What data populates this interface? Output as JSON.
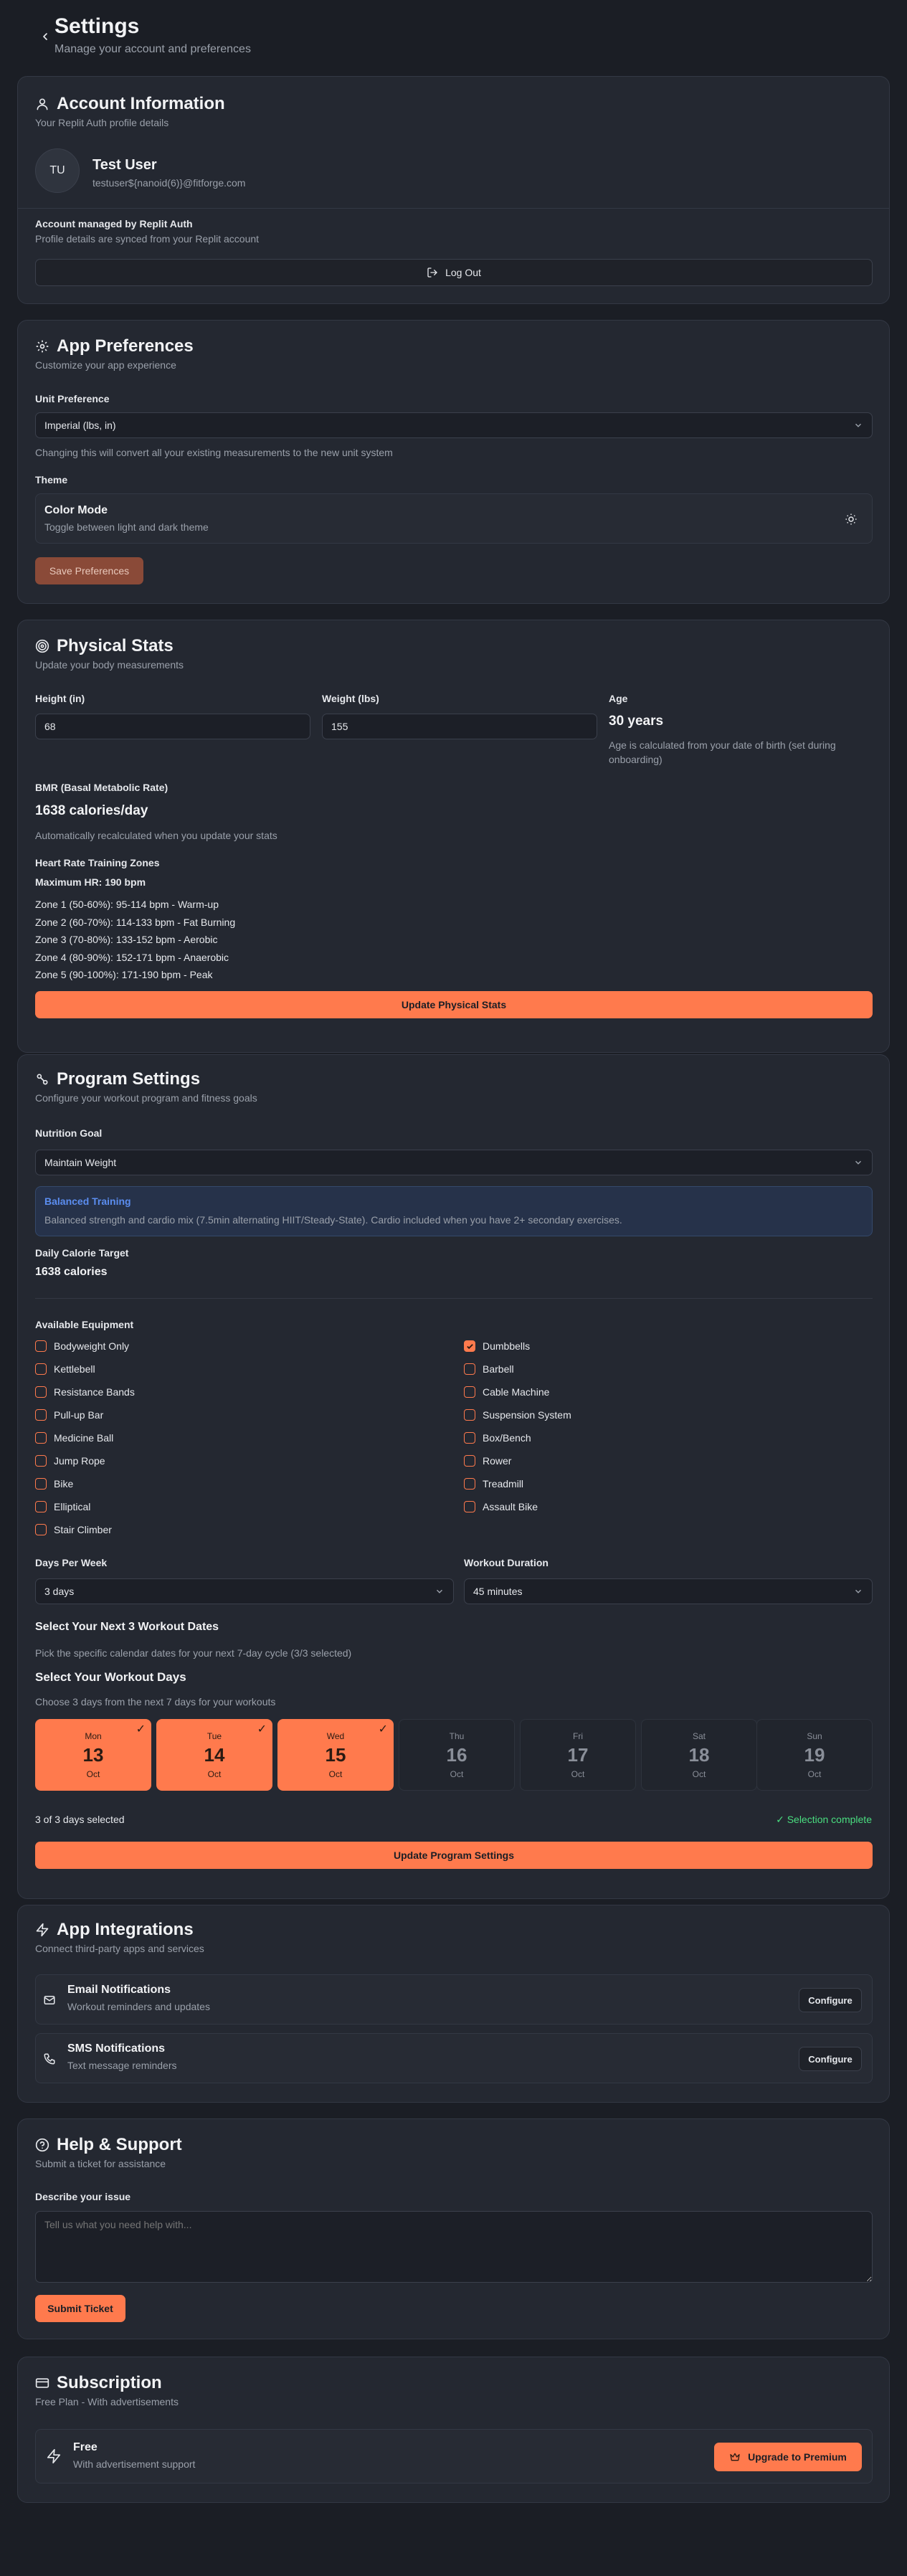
{
  "header": {
    "title": "Settings",
    "subtitle": "Manage your account and preferences"
  },
  "account": {
    "title": "Account Information",
    "subtitle": "Your Replit Auth profile details",
    "avatar_initials": "TU",
    "name": "Test User",
    "email": "testuser${nanoid(6)}@fitforge.com",
    "managed_label": "Account managed by Replit Auth",
    "managed_note": "Profile details are synced from your Replit account",
    "logout_label": "Log Out"
  },
  "preferences": {
    "title": "App Preferences",
    "subtitle": "Customize your app experience",
    "unit_label": "Unit Preference",
    "unit_value": "Imperial (lbs, in)",
    "unit_note": "Changing this will convert all your existing measurements to the new unit system",
    "theme_label": "Theme",
    "color_mode_title": "Color Mode",
    "color_mode_sub": "Toggle between light and dark theme",
    "save_label": "Save Preferences"
  },
  "physical": {
    "title": "Physical Stats",
    "subtitle": "Update your body measurements",
    "height_label": "Height (in)",
    "height_value": "68",
    "weight_label": "Weight (lbs)",
    "weight_value": "155",
    "age_label": "Age",
    "age_value": "30 years",
    "age_note": "Age is calculated from your date of birth (set during onboarding)",
    "bmr_label": "BMR (Basal Metabolic Rate)",
    "bmr_value": "1638 calories/day",
    "bmr_note": "Automatically recalculated when you update your stats",
    "hr_label": "Heart Rate Training Zones",
    "max_hr": "Maximum HR: 190 bpm",
    "zones": [
      "Zone 1 (50-60%): 95-114 bpm - Warm-up",
      "Zone 2 (60-70%): 114-133 bpm - Fat Burning",
      "Zone 3 (70-80%): 133-152 bpm - Aerobic",
      "Zone 4 (80-90%): 152-171 bpm - Anaerobic",
      "Zone 5 (90-100%): 171-190 bpm - Peak"
    ],
    "update_label": "Update Physical Stats"
  },
  "program": {
    "title": "Program Settings",
    "subtitle": "Configure your workout program and fitness goals",
    "nutrition_label": "Nutrition Goal",
    "nutrition_value": "Maintain Weight",
    "info_title": "Balanced Training",
    "info_text": "Balanced strength and cardio mix (7.5min alternating HIIT/Steady-State). Cardio included when you have 2+ secondary exercises.",
    "calorie_label": "Daily Calorie Target",
    "calorie_value": "1638 calories",
    "equipment_label": "Available Equipment",
    "equipment_left": [
      {
        "label": "Bodyweight Only",
        "checked": false
      },
      {
        "label": "Kettlebell",
        "checked": false
      },
      {
        "label": "Resistance Bands",
        "checked": false
      },
      {
        "label": "Pull-up Bar",
        "checked": false
      },
      {
        "label": "Medicine Ball",
        "checked": false
      },
      {
        "label": "Jump Rope",
        "checked": false
      },
      {
        "label": "Bike",
        "checked": false
      },
      {
        "label": "Elliptical",
        "checked": false
      },
      {
        "label": "Stair Climber",
        "checked": false
      }
    ],
    "equipment_right": [
      {
        "label": "Dumbbells",
        "checked": true
      },
      {
        "label": "Barbell",
        "checked": false
      },
      {
        "label": "Cable Machine",
        "checked": false
      },
      {
        "label": "Suspension System",
        "checked": false
      },
      {
        "label": "Box/Bench",
        "checked": false
      },
      {
        "label": "Rower",
        "checked": false
      },
      {
        "label": "Treadmill",
        "checked": false
      },
      {
        "label": "Assault Bike",
        "checked": false
      }
    ],
    "days_label": "Days Per Week",
    "days_value": "3 days",
    "duration_label": "Workout Duration",
    "duration_value": "45 minutes",
    "next_title": "Select Your Next 3 Workout Dates",
    "next_sub": "Pick the specific calendar dates for your next 7-day cycle (3/3 selected)",
    "days_title": "Select Your Workout Days",
    "days_sub": "Choose 3 days from the next 7 days for your workouts",
    "days": [
      {
        "name": "Mon",
        "date": "13",
        "month": "Oct",
        "selected": true
      },
      {
        "name": "Tue",
        "date": "14",
        "month": "Oct",
        "selected": true
      },
      {
        "name": "Wed",
        "date": "15",
        "month": "Oct",
        "selected": true
      },
      {
        "name": "Thu",
        "date": "16",
        "month": "Oct",
        "selected": false
      },
      {
        "name": "Fri",
        "date": "17",
        "month": "Oct",
        "selected": false
      },
      {
        "name": "Sat",
        "date": "18",
        "month": "Oct",
        "selected": false
      },
      {
        "name": "Sun",
        "date": "19",
        "month": "Oct",
        "selected": false
      }
    ],
    "selected_count": "3 of 3 days selected",
    "selection_status": "✓ Selection complete",
    "update_label": "Update Program Settings"
  },
  "integrations": {
    "title": "App Integrations",
    "subtitle": "Connect third-party apps and services",
    "email_title": "Email Notifications",
    "email_sub": "Workout reminders and updates",
    "sms_title": "SMS Notifications",
    "sms_sub": "Text message reminders",
    "configure_label": "Configure"
  },
  "support": {
    "title": "Help & Support",
    "subtitle": "Submit a ticket for assistance",
    "describe_label": "Describe your issue",
    "placeholder": "Tell us what you need help with...",
    "submit_label": "Submit Ticket"
  },
  "subscription": {
    "title": "Subscription",
    "subtitle": "Free Plan - With advertisements",
    "plan_title": "Free",
    "plan_sub": "With advertisement support",
    "upgrade_label": "Upgrade to Premium"
  },
  "colors": {
    "accent": "#ff7a4d",
    "background": "#1b1e25",
    "card": "#242831",
    "success": "#4ade80",
    "info": "#5b8def"
  }
}
